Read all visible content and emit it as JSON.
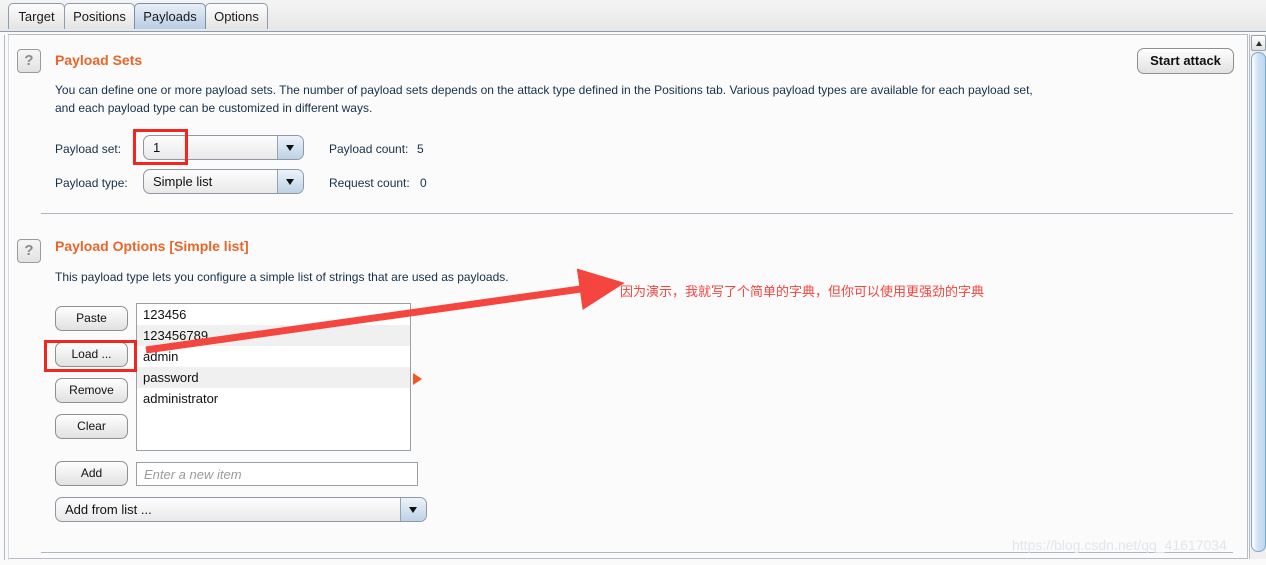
{
  "tabs": [
    {
      "label": "Target",
      "active": false
    },
    {
      "label": "Positions",
      "active": false
    },
    {
      "label": "Payloads",
      "active": true
    },
    {
      "label": "Options",
      "active": false
    }
  ],
  "payload_sets": {
    "help_glyph": "?",
    "title": "Payload Sets",
    "description_line1": "You can define one or more payload sets. The number of payload sets depends on the attack type defined in the Positions tab. Various payload types are available for each payload set,",
    "description_line2": "and each payload type can be customized in different ways.",
    "payload_set_label": "Payload set:",
    "payload_set_value": "1",
    "payload_type_label": "Payload type:",
    "payload_type_value": "Simple list",
    "payload_count_label": "Payload count:",
    "payload_count_value": "5",
    "request_count_label": "Request count:",
    "request_count_value": "0"
  },
  "start_attack_label": "Start attack",
  "payload_options": {
    "help_glyph": "?",
    "title": "Payload Options [Simple list]",
    "description": "This payload type lets you configure a simple list of strings that are used as payloads.",
    "buttons": [
      {
        "label": "Paste"
      },
      {
        "label": "Load ..."
      },
      {
        "label": "Remove"
      },
      {
        "label": "Clear"
      }
    ],
    "items": [
      "123456",
      "123456789",
      "admin",
      "password",
      "administrator"
    ],
    "add_button_label": "Add",
    "new_item_placeholder": "Enter a new item",
    "add_from_list_label": "Add from list ..."
  },
  "annotation": {
    "chinese_note": "因为演示，我就写了个简单的字典，但你可以使用更强劲的字典",
    "highlight_color": "#f4251f",
    "arrow_color": "#f4453f"
  },
  "watermark": "https://blog.csdn.net/qq_41617034"
}
